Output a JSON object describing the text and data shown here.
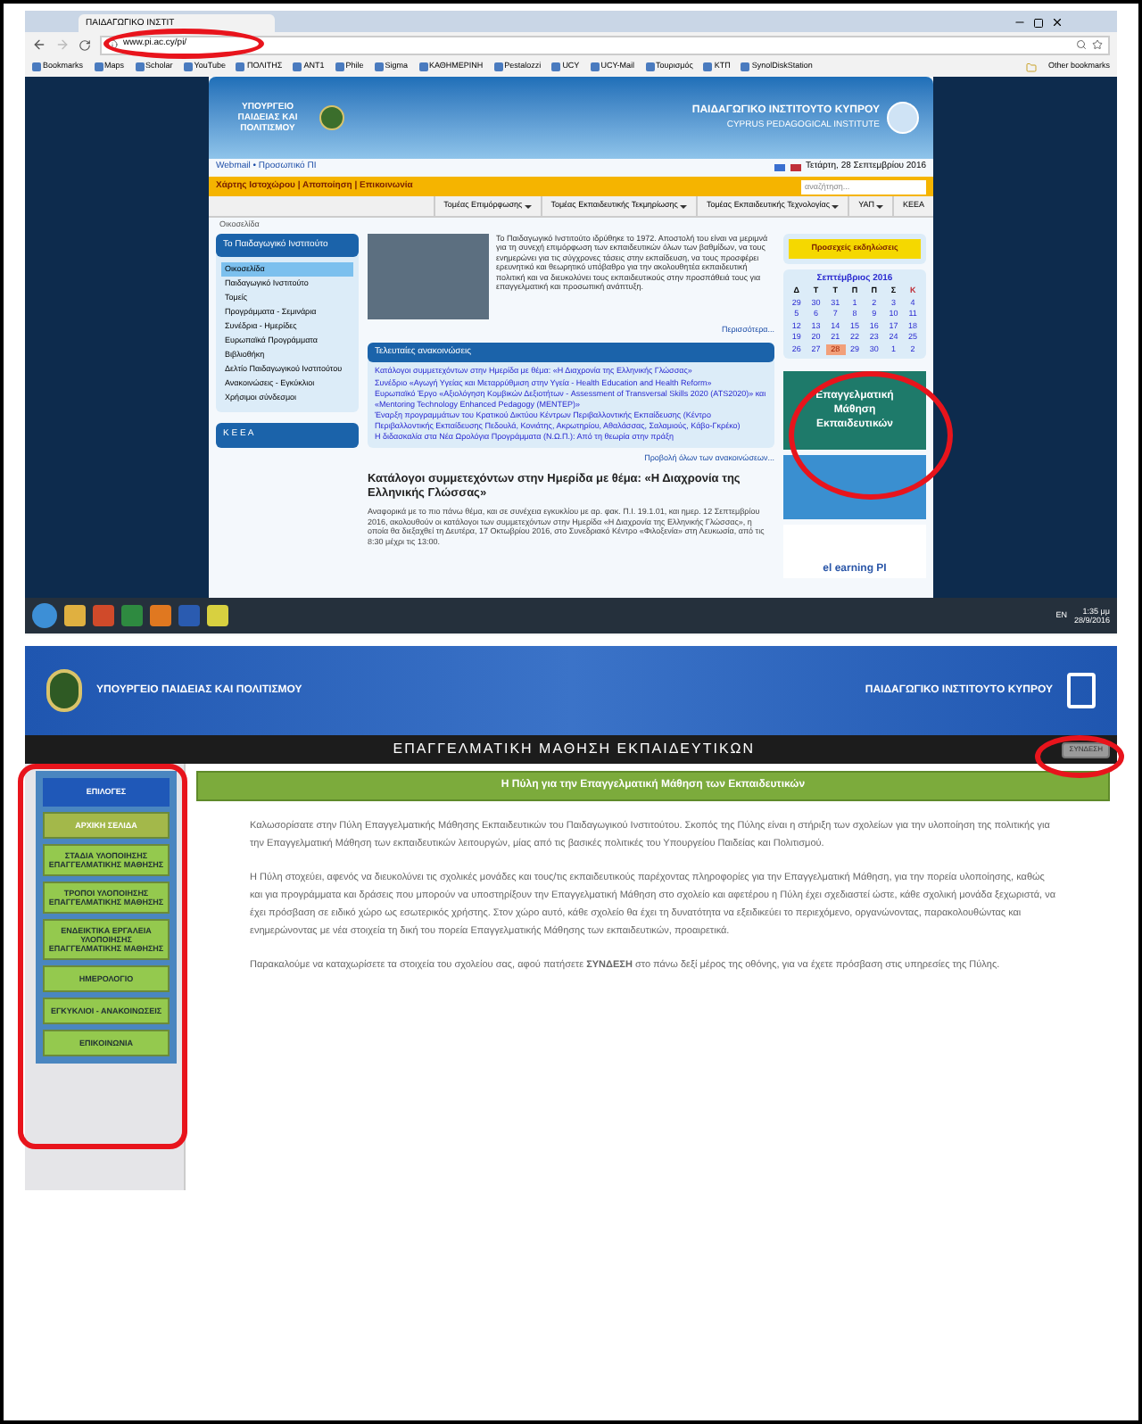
{
  "browser": {
    "tab_title": "ΠΑΙΔΑΓΩΓΙΚΟ ΙΝΣΤΙΤ",
    "url": "www.pi.ac.cy/pi/",
    "bookmarks": [
      "Bookmarks",
      "Maps",
      "Scholar",
      "YouTube",
      "ΠΟΛΙΤΗΣ",
      "ANT1",
      "Phile",
      "Sigma",
      "ΚΑΘΗΜΕΡΙΝΗ",
      "Pestalozzi",
      "UCY",
      "UCY-Mail",
      "Τουρισμός",
      "ΚΤΠ",
      "SynolDiskStation"
    ],
    "other_bookmarks": "Other bookmarks"
  },
  "site": {
    "ministry": "ΥΠΟΥΡΓΕΙΟ ΠΑΙΔΕΙΑΣ ΚΑΙ ΠΟΛΙΤΙΣΜΟΥ",
    "institute": "ΠΑΙΔΑΓΩΓΙΚΟ ΙΝΣΤΙΤΟΥΤΟ ΚΥΠΡΟΥ",
    "institute_en": "CYPRUS PEDAGOGICAL INSTITUTE",
    "top_links": "Webmail • Προσωπικό ΠΙ",
    "date": "Τετάρτη, 28 Σεπτεμβρίου 2016",
    "util_links": "Χάρτης Ιστοχώρου | Αποποίηση | Επικοινωνία",
    "search": {
      "placeholder": "αναζήτηση..."
    },
    "nav": [
      {
        "label": "Τομέας Επιμόρφωσης",
        "dropdown": true
      },
      {
        "label": "Τομέας Εκπαιδευτικής Τεκμηρίωσης",
        "dropdown": true
      },
      {
        "label": "Τομέας Εκπαιδευτικής Τεχνολογίας",
        "dropdown": true
      },
      {
        "label": "ΥΑΠ",
        "dropdown": true
      },
      {
        "label": "ΚΕΕΑ",
        "dropdown": false
      }
    ],
    "breadcrumb": "Οικοσελίδα",
    "sidebar": {
      "title": "Το Παιδαγωγικό Ινστιτούτο",
      "items": [
        {
          "label": "Οικοσελίδα",
          "selected": true
        },
        {
          "label": "Παιδαγωγικό Ινστιτούτο",
          "selected": false
        },
        {
          "label": "Τομείς",
          "selected": false
        },
        {
          "label": "Προγράμματα - Σεμινάρια",
          "selected": false
        },
        {
          "label": "Συνέδρια - Ημερίδες",
          "selected": false
        },
        {
          "label": "Ευρωπαϊκά Προγράμματα",
          "selected": false
        },
        {
          "label": "Βιβλιοθήκη",
          "selected": false
        },
        {
          "label": "Δελτίο Παιδαγωγικού Ινστιτούτου",
          "selected": false
        },
        {
          "label": "Ανακοινώσεις - Εγκύκλιοι",
          "selected": false
        },
        {
          "label": "Χρήσιμοι σύνδεσμοι",
          "selected": false
        }
      ],
      "second_box": "Κ Ε Ε Α"
    },
    "intro": "Το Παιδαγωγικό Ινστιτούτο ιδρύθηκε το 1972. Αποστολή του είναι να μεριμνά για τη συνεχή επιμόρφωση των εκπαιδευτικών όλων των βαθμίδων, να τους ενημερώνει για τις σύγχρονες τάσεις στην εκπαίδευση, να τους προσφέρει ερευνητικό και θεωρητικό υπόβαθρο για την ακολουθητέα εκπαιδευτική πολιτική και να διευκολύνει τους εκπαιδευτικούς στην προσπάθειά τους για επαγγελματική και προσωπική ανάπτυξη.",
    "more": "Περισσότερα...",
    "announcements": {
      "title": "Τελευταίες ανακοινώσεις",
      "items": [
        "Κατάλογοι συμμετεχόντων στην Ημερίδα με θέμα: «Η Διαχρονία της Ελληνικής Γλώσσας»",
        "Συνέδριο «Αγωγή Υγείας και Μεταρρύθμιση στην Υγεία - Health Education and Health Reform»",
        "Ευρωπαϊκό Έργο «Αξιολόγηση Κομβικών Δεξιοτήτων - Assessment of Transversal Skills 2020 (ATS2020)» και «Mentoring Technology Enhanced Pedagogy (MENTEP)»",
        "Έναρξη προγραμμάτων του Κρατικού Δικτύου Κέντρων Περιβαλλοντικής Εκπαίδευσης (Κέντρο Περιβαλλοντικής Εκπαίδευσης Πεδουλά, Κονιάτης, Ακρωτηρίου, Αθαλάσσας, Σαλαμιούς, Κάβο-Γκρέκο)",
        "Η διδασκαλία στα Νέα Ωρολόγια Προγράμματα (Ν.Ω.Π.): Από τη θεωρία στην πράξη"
      ],
      "view_all": "Προβολή όλων των ανακοινώσεων..."
    },
    "article": {
      "title": "Κατάλογοι συμμετεχόντων στην Ημερίδα με θέμα: «Η Διαχρονία της Ελληνικής Γλώσσας»",
      "text": "Αναφορικά με το πιο πάνω θέμα, και σε συνέχεια εγκυκλίου με αρ. φακ. Π.Ι. 19.1.01, και ημερ. 12 Σεπτεμβρίου 2016, ακολουθούν οι κατάλογοι των συμμετεχόντων στην Ημερίδα «Η Διαχρονία της Ελληνικής Γλώσσας», η οποία θα διεξαχθεί τη Δευτέρα, 17 Οκτωβρίου 2016, στο Συνεδριακό Κέντρο «Φιλοξενία» στη Λευκωσία, από τις 8:30 μέχρι τις 13:00."
    },
    "events_button": "Προσεχείς εκδηλώσεις",
    "calendar": {
      "month": "Σεπτέμβριος 2016",
      "weekdays": [
        "Δ",
        "Τ",
        "Τ",
        "Π",
        "Π",
        "Σ",
        "Κ"
      ],
      "days": [
        {
          "label": "29",
          "selected": false
        },
        {
          "label": "30",
          "selected": false
        },
        {
          "label": "31",
          "selected": false
        },
        {
          "label": "1",
          "selected": false
        },
        {
          "label": "2",
          "selected": false
        },
        {
          "label": "3",
          "selected": false
        },
        {
          "label": "4",
          "selected": false
        },
        {
          "label": "5",
          "selected": false
        },
        {
          "label": "6",
          "selected": false
        },
        {
          "label": "7",
          "selected": false
        },
        {
          "label": "8",
          "selected": false
        },
        {
          "label": "9",
          "selected": false
        },
        {
          "label": "10",
          "selected": false
        },
        {
          "label": "11",
          "selected": false
        },
        {
          "label": "12",
          "selected": false
        },
        {
          "label": "13",
          "selected": false
        },
        {
          "label": "14",
          "selected": false
        },
        {
          "label": "15",
          "selected": false
        },
        {
          "label": "16",
          "selected": false
        },
        {
          "label": "17",
          "selected": false
        },
        {
          "label": "18",
          "selected": false
        },
        {
          "label": "19",
          "selected": false
        },
        {
          "label": "20",
          "selected": false
        },
        {
          "label": "21",
          "selected": false
        },
        {
          "label": "22",
          "selected": false
        },
        {
          "label": "23",
          "selected": false
        },
        {
          "label": "24",
          "selected": false
        },
        {
          "label": "25",
          "selected": false
        },
        {
          "label": "26",
          "selected": false
        },
        {
          "label": "27",
          "selected": false
        },
        {
          "label": "28",
          "selected": true
        },
        {
          "label": "29",
          "selected": false
        },
        {
          "label": "30",
          "selected": false
        },
        {
          "label": "1",
          "selected": false
        },
        {
          "label": "2",
          "selected": false
        }
      ]
    },
    "banner_lines": [
      "Επαγγελματική",
      "Μάθηση",
      "Εκπαιδευτικών"
    ],
    "elearning": "el earning PI"
  },
  "taskbar": {
    "language": "EN",
    "time": "1:35 μμ",
    "date": "28/9/2016"
  },
  "portal": {
    "ministry": "ΥΠΟΥΡΓΕΙΟ ΠΑΙΔΕΙΑΣ ΚΑΙ ΠΟΛΙΤΙΣΜΟΥ",
    "institute": "ΠΑΙΔΑΓΩΓΙΚΟ ΙΝΣΤΙΤΟΥΤΟ ΚΥΠΡΟΥ",
    "title": "ΕΠΑΓΓΕΛΜΑΤΙΚΗ ΜΑΘΗΣΗ ΕΚΠΑΙΔΕΥΤΙΚΩΝ",
    "login": "ΣΥΝΔΕΣΗ",
    "menu_title": "ΕΠΙΛΟΓΕΣ",
    "menu": [
      {
        "label": "ΑΡΧΙΚΗ ΣΕΛΙΔΑ",
        "selected": true
      },
      {
        "label": "ΣΤΑΔΙΑ ΥΛΟΠΟΙΗΣΗΣ ΕΠΑΓΓΕΛΜΑΤΙΚΗΣ ΜΑΘΗΣΗΣ",
        "selected": false
      },
      {
        "label": "ΤΡΟΠΟΙ ΥΛΟΠΟΙΗΣΗΣ ΕΠΑΓΓΕΛΜΑΤΙΚΗΣ ΜΑΘΗΣΗΣ",
        "selected": false
      },
      {
        "label": "ΕΝΔΕΙΚΤΙΚΑ ΕΡΓΑΛΕΙΑ ΥΛΟΠΟΙΗΣΗΣ ΕΠΑΓΓΕΛΜΑΤΙΚΗΣ ΜΑΘΗΣΗΣ",
        "selected": false
      },
      {
        "label": "ΗΜΕΡΟΛΟΓΙΟ",
        "selected": false
      },
      {
        "label": "ΕΓΚΥΚΛΙΟΙ - ΑΝΑΚΟΙΝΩΣΕΙΣ",
        "selected": false
      },
      {
        "label": "ΕΠΙΚΟΙΝΩΝΙΑ",
        "selected": false
      }
    ],
    "content_title": "Η Πύλη για την Επαγγελματική Μάθηση των Εκπαιδευτικών",
    "paragraphs": [
      "Καλωσορίσατε στην Πύλη Επαγγελματικής Μάθησης Εκπαιδευτικών του Παιδαγωγικού Ινστιτούτου. Σκοπός της Πύλης είναι η στήριξη των σχολείων για την υλοποίηση της πολιτικής για την Επαγγελματική Μάθηση των εκπαιδευτικών λειτουργών, μίας από τις βασικές πολιτικές του Υπουργείου Παιδείας και Πολιτισμού.",
      "Η Πύλη στοχεύει, αφενός να διευκολύνει τις σχολικές μονάδες και τους/τις εκπαιδευτικούς παρέχοντας πληροφορίες για την Επαγγελματική Μάθηση, για την πορεία υλοποίησης, καθώς και για προγράμματα και δράσεις που μπορούν να υποστηρίξουν την Επαγγελματική Μάθηση στο σχολείο και αφετέρου η Πύλη έχει σχεδιαστεί ώστε, κάθε σχολική μονάδα ξεχωριστά, να έχει πρόσβαση σε ειδικό χώρο ως εσωτερικός χρήστης. Στον χώρο αυτό, κάθε σχολείο θα έχει τη δυνατότητα να εξειδικεύει το περιεχόμενο, οργανώνοντας, παρακολουθώντας και ενημερώνοντας με νέα στοιχεία τη δική του πορεία Επαγγελματικής Μάθησης των εκπαιδευτικών, προαιρετικά.",
      "Παρακαλούμε να καταχωρίσετε τα στοιχεία του σχολείου σας, αφού πατήσετε **ΣΥΝΔΕΣΗ** στο πάνω δεξί μέρος της οθόνης, για να έχετε πρόσβαση στις υπηρεσίες της Πύλης."
    ]
  }
}
